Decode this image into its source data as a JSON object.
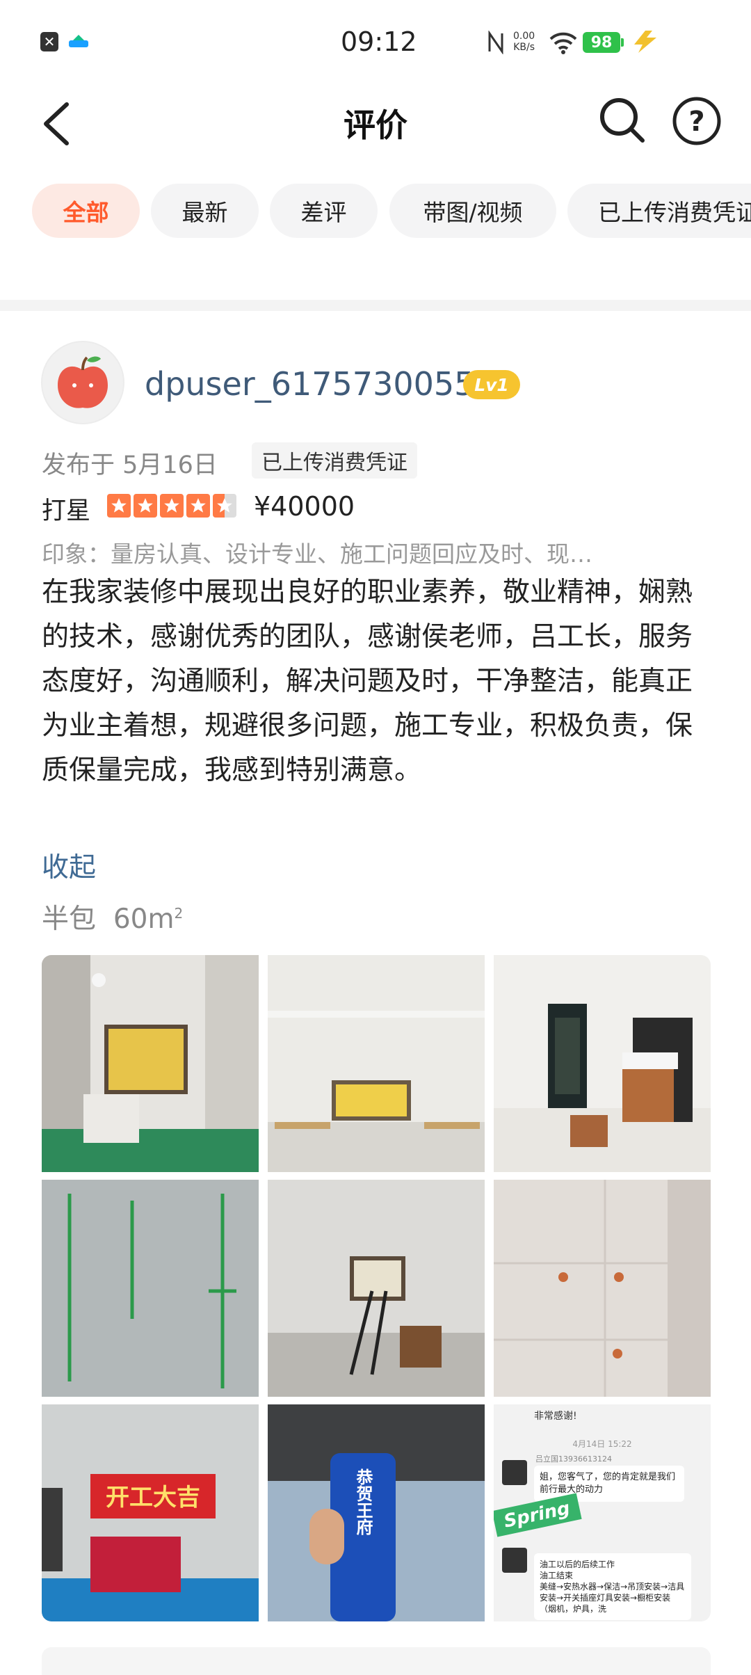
{
  "status_bar": {
    "time": "09:12",
    "network_speed": "0.00",
    "network_unit": "KB/s",
    "battery": "98"
  },
  "header": {
    "title": "评价"
  },
  "filters": [
    "全部",
    "最新",
    "差评",
    "带图/视频",
    "已上传消费凭证"
  ],
  "review": {
    "username": "dpuser_6175730055",
    "level": "Lv1",
    "published": "发布于 5月16日",
    "receipt_tag": "已上传消费凭证",
    "rating_label": "打星",
    "rating_stars": 4.5,
    "price": "¥40000",
    "impression": "印象：量房认真、设计专业、施工问题回应及时、现…",
    "content": "在我家装修中展现出良好的职业素养，敬业精神，娴熟的技术，感谢优秀的团队，感谢侯老师，吕工长，服务态度好，沟通顺利，解决问题及时，干净整洁，能真正为业主着想，规避很多问题，施工专业，积极负责，保质保量完成，我感到特别满意。",
    "collapse": "收起",
    "package": "半包",
    "area": "60m",
    "area_unit": "2"
  },
  "photos": {
    "banner_text": "开工大吉",
    "can_text": "恭贺王府",
    "chat_header": "非常感谢!",
    "chat_time": "4月14日 15:22",
    "chat_name": "吕立国13936613124",
    "chat_msg1": "姐，您客气了，您的肯定就是我们前行最大的动力",
    "chat_msg2": "油工以后的后续工作\n油工结束\n美缝→安热水器→保洁→吊顶安装→洁具安装→开关插座灯具安装→橱柜安装（烟机，炉具，洗",
    "sticker_text": "Spring"
  }
}
